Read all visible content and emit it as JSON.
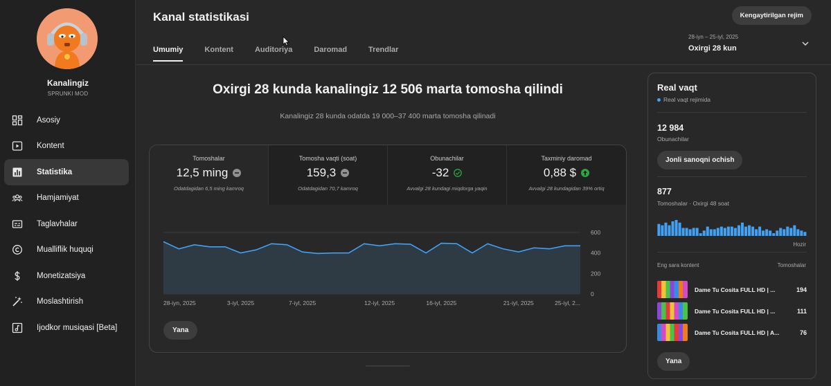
{
  "sidebar": {
    "channel_name": "Kanalingiz",
    "channel_subtitle": "SPRUNKI MOD",
    "items": [
      {
        "label": "Asosiy",
        "icon": "dashboard-icon"
      },
      {
        "label": "Kontent",
        "icon": "content-icon"
      },
      {
        "label": "Statistika",
        "icon": "analytics-icon",
        "active": true
      },
      {
        "label": "Hamjamiyat",
        "icon": "community-icon"
      },
      {
        "label": "Taglavhalar",
        "icon": "subtitles-icon"
      },
      {
        "label": "Mualliflik huquqi",
        "icon": "copyright-icon"
      },
      {
        "label": "Monetizatsiya",
        "icon": "dollar-icon"
      },
      {
        "label": "Moslashtirish",
        "icon": "magic-wand-icon"
      },
      {
        "label": "Ijodkor musiqasi [Beta]",
        "icon": "music-icon"
      }
    ]
  },
  "header": {
    "title": "Kanal statistikasi",
    "advanced_button": "Kengaytirilgan rejim",
    "date_range": "28-iyn – 25-iyl, 2025",
    "date_label": "Oxirgi 28 kun",
    "tabs": [
      {
        "label": "Umumiy",
        "active": true
      },
      {
        "label": "Kontent"
      },
      {
        "label": "Auditoriya"
      },
      {
        "label": "Daromad"
      },
      {
        "label": "Trendlar"
      }
    ]
  },
  "main": {
    "headline": "Oxirgi 28 kunda kanalingiz 12 506 marta tomosha qilindi",
    "subheadline": "Kanalingiz 28 kunda odatda 19 000–37 400 marta tomosha qilinadi",
    "more_button": "Yana",
    "metrics": [
      {
        "label": "Tomoshalar",
        "value": "12,5 ming",
        "note": "Odatdagidan 6,5 ming kamroq",
        "icon": "minus-circle-icon"
      },
      {
        "label": "Tomosha vaqti (soat)",
        "value": "159,3",
        "note": "Odatdagidan 70,7 kamroq",
        "icon": "minus-circle-icon"
      },
      {
        "label": "Obunachilar",
        "value": "-32",
        "note": "Avvalgi 28 kundagi miqdorga yaqin",
        "icon": "check-circle-icon"
      },
      {
        "label": "Taxminiy daromad",
        "value": "0,88 $",
        "note": "Avvalgi 28 kundagidan 39% ortiq",
        "icon": "arrow-up-icon"
      }
    ]
  },
  "chart_data": {
    "type": "area",
    "x": [
      "28-iyn",
      "29-iyn",
      "30-iyn",
      "1-iyl",
      "2-iyl",
      "3-iyl",
      "4-iyl",
      "5-iyl",
      "6-iyl",
      "7-iyl",
      "8-iyl",
      "9-iyl",
      "10-iyl",
      "11-iyl",
      "12-iyl",
      "13-iyl",
      "14-iyl",
      "15-iyl",
      "16-iyl",
      "17-iyl",
      "18-iyl",
      "19-iyl",
      "20-iyl",
      "21-iyl",
      "22-iyl",
      "23-iyl",
      "24-iyl",
      "25-iyl"
    ],
    "values": [
      510,
      440,
      480,
      460,
      460,
      400,
      430,
      490,
      480,
      410,
      395,
      400,
      400,
      490,
      470,
      490,
      485,
      400,
      495,
      490,
      400,
      490,
      440,
      410,
      450,
      440,
      470,
      470
    ],
    "x_tick_labels": [
      "28-iyn, 2025",
      "3-iyl, 2025",
      "7-iyl, 2025",
      "12-iyl, 2025",
      "16-iyl, 2025",
      "21-iyl, 2025",
      "25-iyl, 2..."
    ],
    "x_tick_indices": [
      0,
      5,
      9,
      14,
      18,
      23,
      27
    ],
    "y_ticks": [
      0,
      200,
      400,
      600
    ],
    "ylim": [
      0,
      600
    ],
    "grid": true,
    "line_color": "#41a1f5",
    "fill_color": "#2e3a44"
  },
  "realtime": {
    "title": "Real vaqt",
    "live_label": "Real vaqt rejimida",
    "subscribers": "12 984",
    "subscribers_label": "Obunachilar",
    "live_count_button": "Jonli sanoqni ochish",
    "views": "877",
    "views_label": "Tomoshalar · Oxirgi 48 soat",
    "bars": [
      9,
      8,
      10,
      8,
      11,
      12,
      10,
      6,
      6,
      5,
      6,
      6,
      2,
      4,
      7,
      5,
      5,
      6,
      7,
      6,
      7,
      7,
      6,
      8,
      10,
      7,
      8,
      7,
      5,
      7,
      4,
      5,
      4,
      2,
      4,
      6,
      5,
      7,
      6,
      8,
      5,
      4,
      3
    ],
    "now_label": "Hozir",
    "top_content_label": "Eng sara kontent",
    "top_content_metric": "Tomoshalar",
    "top_content": [
      {
        "title": "Dame Tu Cosita FULL HD | ...",
        "views": "194"
      },
      {
        "title": "Dame Tu Cosita FULL HD | ...",
        "views": "111"
      },
      {
        "title": "Dame Tu Cosita FULL HD | A...",
        "views": "76"
      }
    ],
    "more_button": "Yana",
    "accent_color": "#41a1f5"
  }
}
